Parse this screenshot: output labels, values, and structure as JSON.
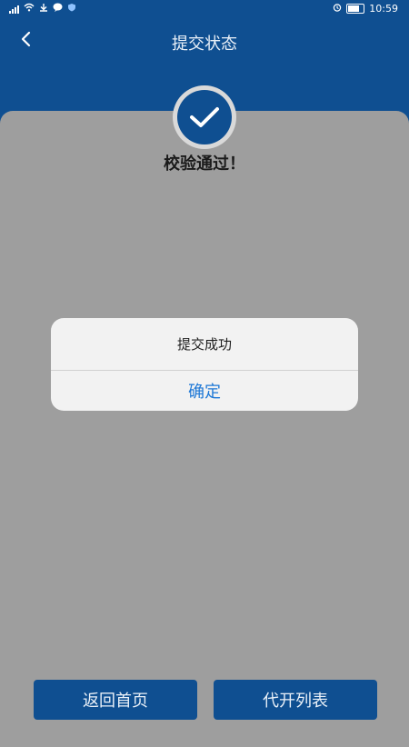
{
  "status_bar": {
    "time": "10:59"
  },
  "header": {
    "title": "提交状态"
  },
  "content": {
    "verify_text": "校验通过！"
  },
  "dialog": {
    "message": "提交成功",
    "confirm_label": "确定"
  },
  "bottom_buttons": {
    "home_label": "返回首页",
    "list_label": "代开列表"
  },
  "colors": {
    "primary": "#0f4f91",
    "overlay_gray": "#9e9e9e",
    "dialog_bg": "#f2f2f2",
    "link_blue": "#1e78d6"
  },
  "icons": {
    "back": "chevron-left-icon",
    "success": "check-circle-icon"
  }
}
